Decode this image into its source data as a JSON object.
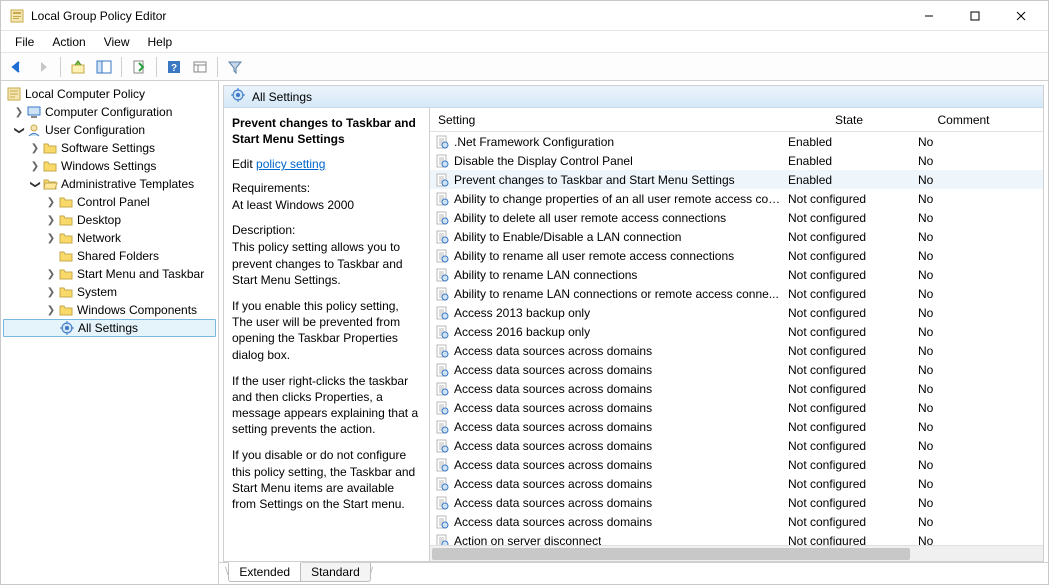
{
  "window": {
    "title": "Local Group Policy Editor"
  },
  "menubar": [
    "File",
    "Action",
    "View",
    "Help"
  ],
  "tree": {
    "root": "Local Computer Policy",
    "computer_config": "Computer Configuration",
    "user_config": "User Configuration",
    "software_settings": "Software Settings",
    "windows_settings": "Windows Settings",
    "admin_templates": "Administrative Templates",
    "control_panel": "Control Panel",
    "desktop": "Desktop",
    "network": "Network",
    "shared_folders": "Shared Folders",
    "start_taskbar": "Start Menu and Taskbar",
    "system": "System",
    "win_components": "Windows Components",
    "all_settings": "All Settings"
  },
  "header": {
    "title": "All Settings"
  },
  "description": {
    "title": "Prevent changes to Taskbar and Start Menu Settings",
    "edit_prefix": "Edit ",
    "edit_link": "policy setting ",
    "req_label": "Requirements:",
    "req_text": "At least Windows 2000",
    "desc_label": "Description:",
    "p1": "This policy setting allows you to prevent changes to Taskbar and Start Menu Settings.",
    "p2": "If you enable this policy setting, The user will be prevented from opening the Taskbar Properties dialog box.",
    "p3": "If the user right-clicks the taskbar and then clicks Properties, a message appears explaining that a setting prevents the action.",
    "p4": "If you disable or do not configure this policy setting, the Taskbar and Start Menu items are available from Settings on the Start menu."
  },
  "columns": {
    "setting": "Setting",
    "state": "State",
    "comment": "Comment"
  },
  "rows": [
    {
      "name": ".Net Framework Configuration",
      "state": "Enabled",
      "comment": "No"
    },
    {
      "name": "Disable the Display Control Panel",
      "state": "Enabled",
      "comment": "No"
    },
    {
      "name": "Prevent changes to Taskbar and Start Menu Settings",
      "state": "Enabled",
      "comment": "No",
      "selected": true
    },
    {
      "name": "Ability to change properties of an all user remote access con...",
      "state": "Not configured",
      "comment": "No"
    },
    {
      "name": "Ability to delete all user remote access connections",
      "state": "Not configured",
      "comment": "No"
    },
    {
      "name": "Ability to Enable/Disable a LAN connection",
      "state": "Not configured",
      "comment": "No"
    },
    {
      "name": "Ability to rename all user remote access connections",
      "state": "Not configured",
      "comment": "No"
    },
    {
      "name": "Ability to rename LAN connections",
      "state": "Not configured",
      "comment": "No"
    },
    {
      "name": "Ability to rename LAN connections or remote access conne...",
      "state": "Not configured",
      "comment": "No"
    },
    {
      "name": "Access 2013 backup only",
      "state": "Not configured",
      "comment": "No"
    },
    {
      "name": "Access 2016 backup only",
      "state": "Not configured",
      "comment": "No"
    },
    {
      "name": "Access data sources across domains",
      "state": "Not configured",
      "comment": "No"
    },
    {
      "name": "Access data sources across domains",
      "state": "Not configured",
      "comment": "No"
    },
    {
      "name": "Access data sources across domains",
      "state": "Not configured",
      "comment": "No"
    },
    {
      "name": "Access data sources across domains",
      "state": "Not configured",
      "comment": "No"
    },
    {
      "name": "Access data sources across domains",
      "state": "Not configured",
      "comment": "No"
    },
    {
      "name": "Access data sources across domains",
      "state": "Not configured",
      "comment": "No"
    },
    {
      "name": "Access data sources across domains",
      "state": "Not configured",
      "comment": "No"
    },
    {
      "name": "Access data sources across domains",
      "state": "Not configured",
      "comment": "No"
    },
    {
      "name": "Access data sources across domains",
      "state": "Not configured",
      "comment": "No"
    },
    {
      "name": "Access data sources across domains",
      "state": "Not configured",
      "comment": "No"
    },
    {
      "name": "Action on server disconnect",
      "state": "Not configured",
      "comment": "No"
    }
  ],
  "tabs": {
    "extended": "Extended",
    "standard": "Standard"
  }
}
